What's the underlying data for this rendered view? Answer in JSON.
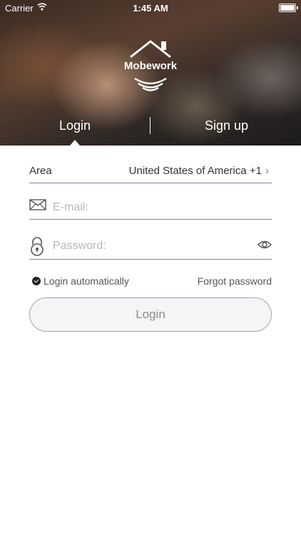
{
  "status_bar": {
    "carrier": "Carrier",
    "time": "1:45 AM"
  },
  "brand": {
    "name": "Mobework"
  },
  "tabs": {
    "login": "Login",
    "signup": "Sign up"
  },
  "form": {
    "area_label": "Area",
    "area_value": "United States of America +1",
    "email_placeholder": "E-mail:",
    "password_placeholder": "Password:",
    "auto_login_label": "Login automatically",
    "auto_login_checked": true,
    "forgot_label": "Forgot password",
    "login_button": "Login"
  },
  "icons": [
    "wifi-icon",
    "battery-icon",
    "house-logo-icon",
    "signal-waves-icon",
    "envelope-icon",
    "lock-icon",
    "eye-icon",
    "chevron-right-icon",
    "checkmark-icon"
  ],
  "colors": {
    "field_underline": "#7a8a95",
    "placeholder": "#b5b9bd",
    "button_bg": "#f5f5f7",
    "button_text": "#8c8c8c"
  }
}
